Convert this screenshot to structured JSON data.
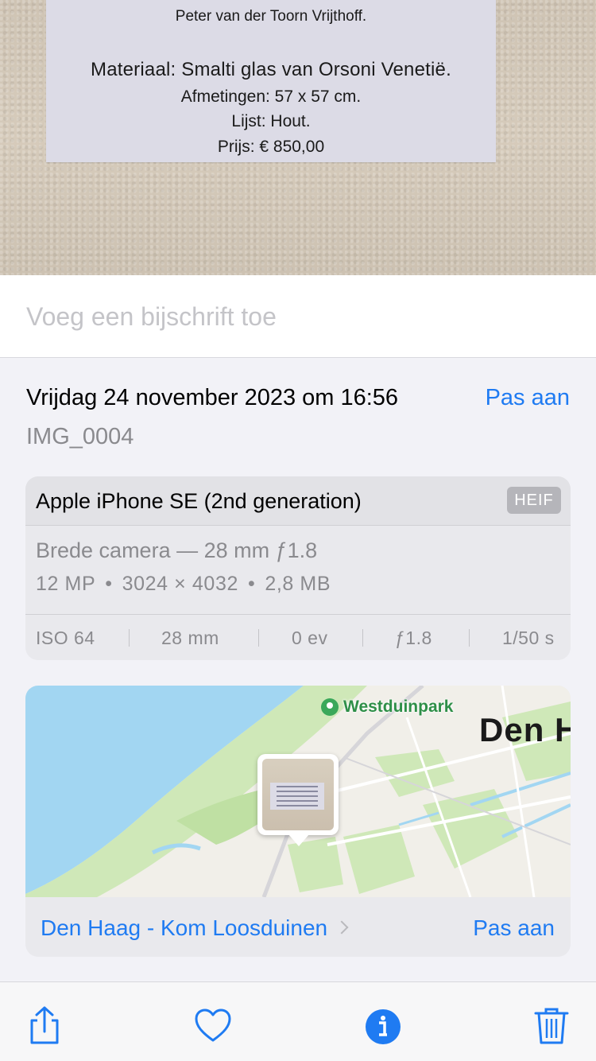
{
  "photo": {
    "label_lines": {
      "subtitle": "Peter van der Toorn Vrijthoff.",
      "material": "Materiaal: Smalti glas van Orsoni Venetië.",
      "dimensions": "Afmetingen: 57 x 57 cm.",
      "frame": "Lijst: Hout.",
      "price": "Prijs: € 850,00"
    }
  },
  "caption": {
    "placeholder": "Voeg een bijschrift toe"
  },
  "info": {
    "date": "Vrijdag 24 november 2023 om 16:56",
    "date_edit_label": "Pas aan",
    "filename": "IMG_0004"
  },
  "camera": {
    "model": "Apple iPhone SE (2nd generation)",
    "format_badge": "HEIF",
    "lens": "Brede camera — 28 mm ƒ1.8",
    "megapixels": "12 MP",
    "resolution": "3024 × 4032",
    "size": "2,8 MB",
    "exif": {
      "iso": "ISO 64",
      "focal": "28 mm",
      "ev": "0 ev",
      "aperture": "ƒ1.8",
      "shutter": "1/50 s"
    }
  },
  "map": {
    "poi_label": "Westduinpark",
    "city_label": "Den H",
    "location": "Den Haag - Kom Loosduinen",
    "edit_label": "Pas aan",
    "colors": {
      "sea": "#a2d6f2",
      "dune": "#cfe8b8",
      "land": "#f1efe9",
      "accent": "#1f7bf2"
    }
  },
  "toolbar": {
    "icons": [
      "share-icon",
      "heart-icon",
      "info-icon",
      "trash-icon"
    ],
    "accent": "#1f7bf2"
  }
}
